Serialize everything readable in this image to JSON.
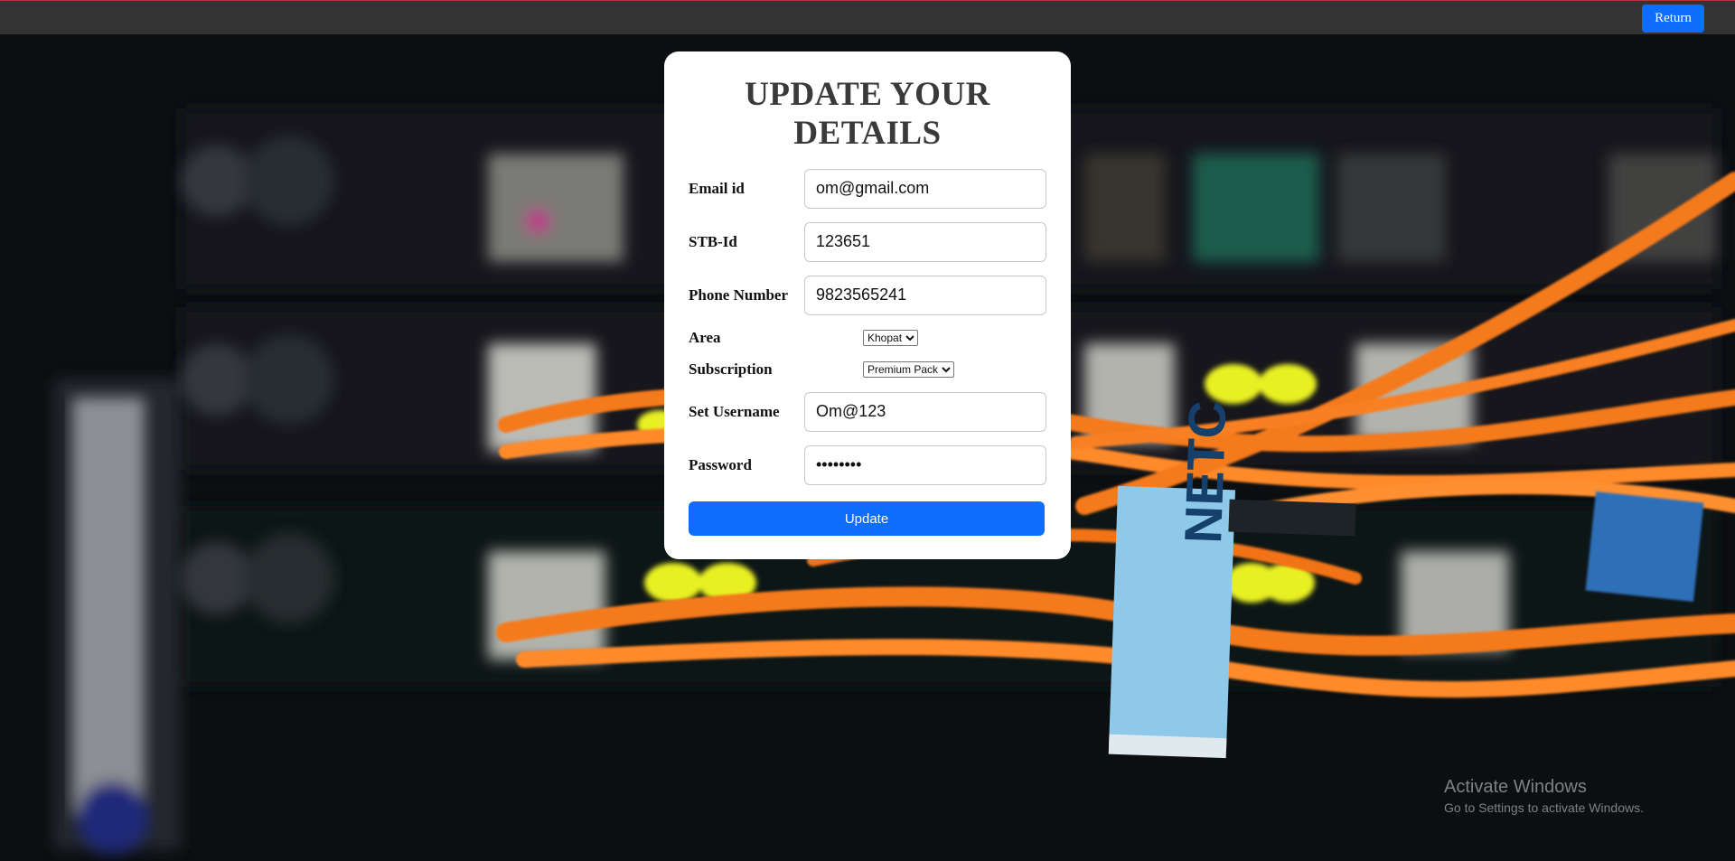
{
  "topbar": {
    "return_label": "Return"
  },
  "form": {
    "title": "UPDATE YOUR DETAILS",
    "fields": {
      "email": {
        "label": "Email id",
        "value": "om@gmail.com"
      },
      "stb": {
        "label": "STB-Id",
        "value": "123651"
      },
      "phone": {
        "label": "Phone Number",
        "value": "9823565241"
      },
      "area": {
        "label": "Area",
        "selected": "Khopat"
      },
      "subscription": {
        "label": "Subscription",
        "selected": "Premium Pack"
      },
      "username": {
        "label": "Set Username",
        "value": "Om@123"
      },
      "password": {
        "label": "Password",
        "value": "********"
      }
    },
    "update_label": "Update"
  },
  "watermark": {
    "line1": "Activate Windows",
    "line2": "Go to Settings to activate Windows."
  },
  "colors": {
    "topbar": "#333333",
    "accent": "#0d6efd",
    "card": "#ffffff"
  }
}
